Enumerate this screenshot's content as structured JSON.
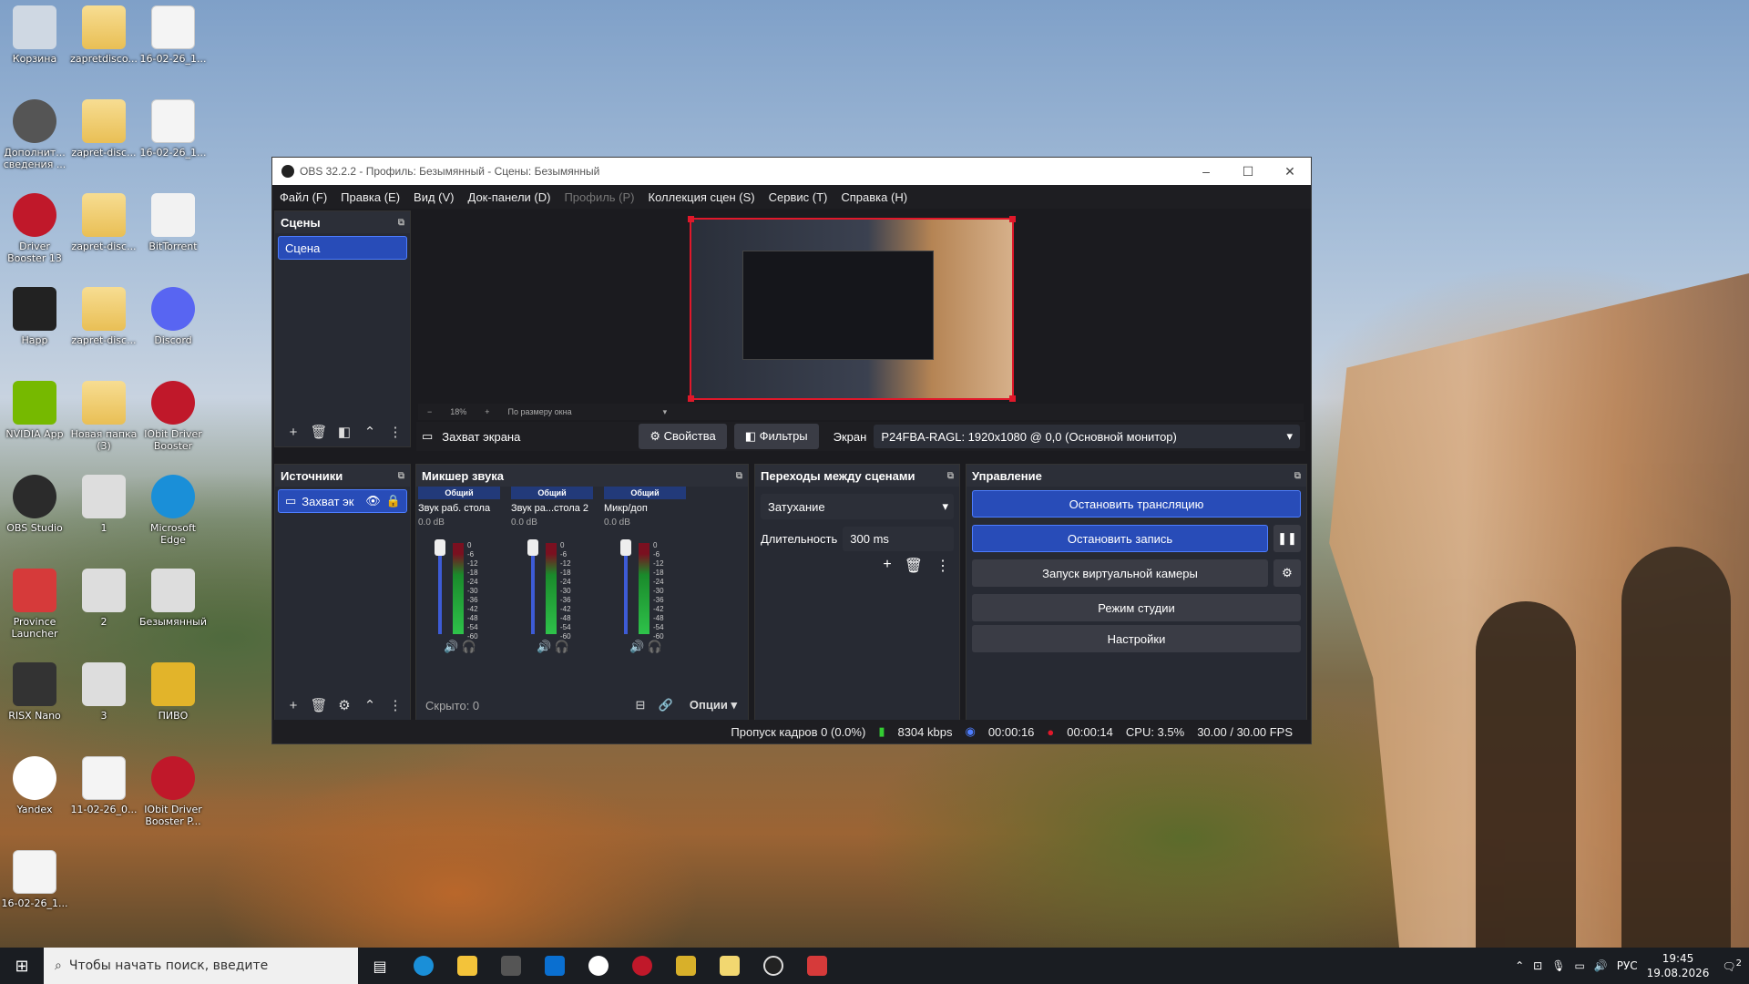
{
  "desktop": {
    "icons": [
      {
        "label": "Корзина",
        "icon": "recycle-bin-icon"
      },
      {
        "label": "zapretdisco...",
        "icon": "folder-icon"
      },
      {
        "label": "16-02-26_1...",
        "icon": "document-icon"
      },
      {
        "label": "Дополнит... сведения ...",
        "icon": "system-icon"
      },
      {
        "label": "zapret-disc...",
        "icon": "folder-icon"
      },
      {
        "label": "16-02-26_1...",
        "icon": "document-icon"
      },
      {
        "label": "Driver Booster 13",
        "icon": "driver-booster-icon"
      },
      {
        "label": "zapret-disc...",
        "icon": "folder-icon"
      },
      {
        "label": "BitTorrent",
        "icon": "bittorrent-icon"
      },
      {
        "label": "Happ",
        "icon": "happ-icon"
      },
      {
        "label": "zapret-disc...",
        "icon": "folder-icon"
      },
      {
        "label": "Discord",
        "icon": "discord-icon"
      },
      {
        "label": "NVIDIA App",
        "icon": "nvidia-icon"
      },
      {
        "label": "Новая папка (3)",
        "icon": "folder-icon"
      },
      {
        "label": "IObit Driver Booster",
        "icon": "iobit-icon"
      },
      {
        "label": "OBS Studio",
        "icon": "obs-icon"
      },
      {
        "label": "1",
        "icon": "shortcut-icon"
      },
      {
        "label": "Microsoft Edge",
        "icon": "edge-icon"
      },
      {
        "label": "Province Launcher",
        "icon": "province-icon"
      },
      {
        "label": "2",
        "icon": "shortcut-icon"
      },
      {
        "label": "Безымянный",
        "icon": "shortcut-icon"
      },
      {
        "label": "RISX Nano",
        "icon": "risx-icon"
      },
      {
        "label": "3",
        "icon": "shortcut-icon"
      },
      {
        "label": "ПИВО",
        "icon": "beer-icon"
      },
      {
        "label": "Yandex",
        "icon": "yandex-icon"
      },
      {
        "label": "11-02-26_0...",
        "icon": "document-icon"
      },
      {
        "label": "IObit Driver Booster P...",
        "icon": "iobit-icon"
      },
      {
        "label": "16-02-26_1...",
        "icon": "document-icon"
      }
    ]
  },
  "obs": {
    "title": "OBS 32.2.2 - Профиль: Безымянный - Сцены: Безымянный",
    "menu": [
      "Файл (F)",
      "Правка (E)",
      "Вид (V)",
      "Док-панели (D)",
      "Профиль (P)",
      "Коллекция сцен (S)",
      "Сервис (T)",
      "Справка (H)"
    ],
    "scenes": {
      "title": "Сцены",
      "items": [
        "Сцена"
      ]
    },
    "sources": {
      "title": "Источники",
      "items": [
        "Захват эк"
      ]
    },
    "zoom": {
      "percent": "18%",
      "mode": "По размеру окна"
    },
    "source_bar": {
      "name": "Захват экрана",
      "properties": "Свойства",
      "filters": "Фильтры",
      "screen_label": "Экран",
      "screen_value": "P24FBA-RAGL: 1920x1080 @ 0,0 (Основной монитор)"
    },
    "mixer": {
      "title": "Микшер звука",
      "channels": [
        {
          "head": "Общий",
          "name": "Звук раб. стола",
          "db": "0.0 dB"
        },
        {
          "head": "Общий",
          "name": "Звук ра...стола 2",
          "db": "0.0 dB"
        },
        {
          "head": "Общий",
          "name": "Микр/доп",
          "db": "0.0 dB"
        }
      ],
      "scale": [
        "0",
        "-6",
        "-12",
        "-18",
        "-24",
        "-30",
        "-36",
        "-42",
        "-48",
        "-54",
        "-60"
      ],
      "hidden": "Скрыто: 0",
      "options": "Опции"
    },
    "transitions": {
      "title": "Переходы между сценами",
      "type": "Затухание",
      "duration_label": "Длительность",
      "duration": "300 ms"
    },
    "controls": {
      "title": "Управление",
      "stop_stream": "Остановить трансляцию",
      "stop_record": "Остановить запись",
      "virtual_cam": "Запуск виртуальной камеры",
      "studio": "Режим студии",
      "settings": "Настройки"
    },
    "status": {
      "dropped": "Пропуск кадров 0 (0.0%)",
      "bitrate": "8304 kbps",
      "stream_time": "00:00:16",
      "rec_time": "00:00:14",
      "cpu": "CPU: 3.5%",
      "fps": "30.00 / 30.00 FPS"
    }
  },
  "taskbar": {
    "search_placeholder": "Чтобы начать поиск, введите",
    "lang": "РУС",
    "time": "19:45",
    "date": "19.08.2026",
    "notif": "2"
  }
}
